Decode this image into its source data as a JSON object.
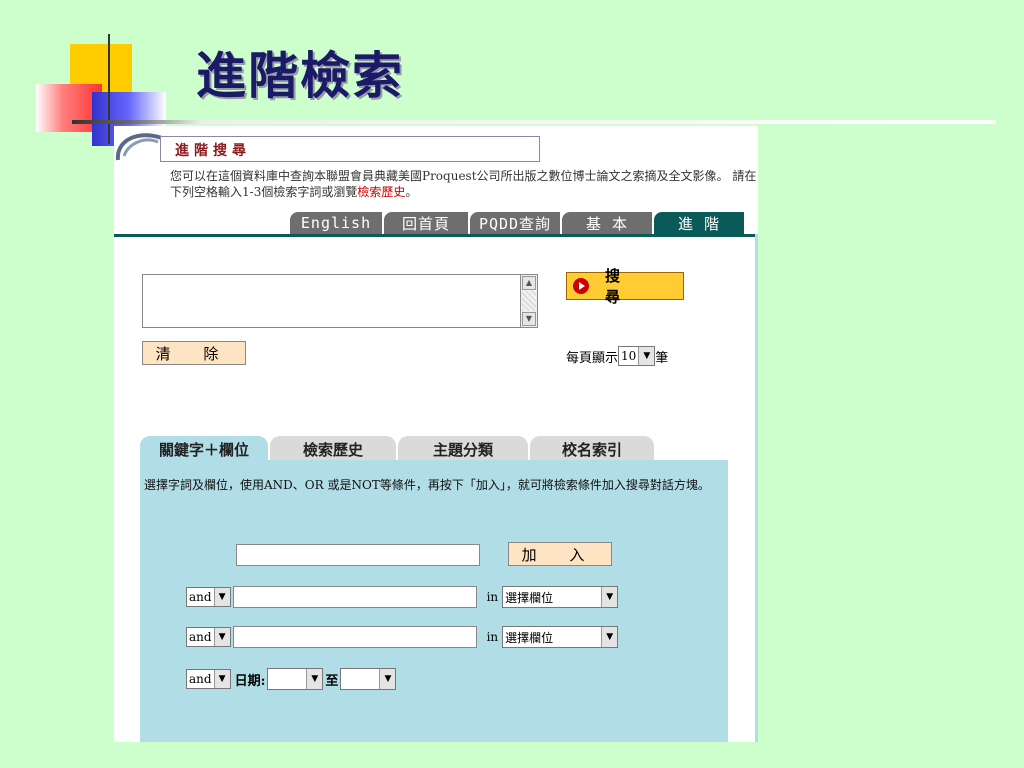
{
  "slide": {
    "title": "進階檢索"
  },
  "screenshot": {
    "header_title": "進階搜尋",
    "intro_text": "您可以在這個資料庫中查詢本聯盟會員典藏美國Proquest公司所出版之數位博士論文之索摘及全文影像。 請在下列空格輸入1-3個檢索字詞或瀏覽",
    "intro_link": "檢索歷史",
    "intro_end": "。",
    "top_tabs": [
      {
        "label": "English"
      },
      {
        "label": "回首頁"
      },
      {
        "label": "PQDD查詢"
      },
      {
        "label": "基 本"
      },
      {
        "label": "進 階"
      }
    ],
    "search_button": "搜 尋",
    "clear_button": "清 除",
    "per_page_prefix": "每頁顯示",
    "per_page_value": "10",
    "per_page_suffix": "筆",
    "lower_tabs": [
      {
        "label": "關鍵字＋欄位"
      },
      {
        "label": "檢索歷史"
      },
      {
        "label": "主題分類"
      },
      {
        "label": "校名索引"
      }
    ],
    "panel_desc": "選擇字詞及欄位，使用AND、OR 或是NOT等條件，再按下「加入」，就可將檢索條件加入搜尋對話方塊。",
    "add_button": "加 入",
    "operator": "and",
    "in_label": "in",
    "field_select": "選擇欄位",
    "date_label": "日期:",
    "to_label": "至"
  },
  "colors": {
    "background": "#ccffcc",
    "title": "#1a1a66",
    "tab_active": "#0b5a5a",
    "tab_inactive": "#6e6e6e",
    "panel": "#b0dde6",
    "search_button": "#ffcc33"
  }
}
